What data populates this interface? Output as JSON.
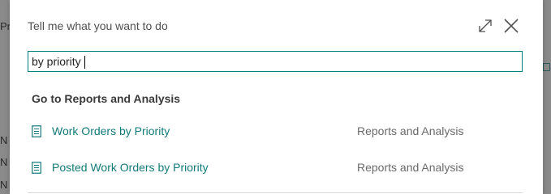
{
  "background": {
    "left_fragments": [
      "Pr",
      "N",
      "N",
      "N"
    ],
    "right_icon": "document-icon"
  },
  "dialog": {
    "title": "Tell me what you want to do",
    "expand_icon": "expand-icon",
    "close_icon": "close-icon"
  },
  "search": {
    "value": "by priority",
    "placeholder": ""
  },
  "results": {
    "group_heading": "Go to Reports and Analysis",
    "items": [
      {
        "label": "Work Orders by Priority",
        "category": "Reports and Analysis",
        "icon": "report-icon"
      },
      {
        "label": "Posted Work Orders by Priority",
        "category": "Reports and Analysis",
        "icon": "report-icon"
      }
    ]
  },
  "colors": {
    "accent": "#00807a",
    "link": "#127a78",
    "muted": "#6a6a6a"
  }
}
